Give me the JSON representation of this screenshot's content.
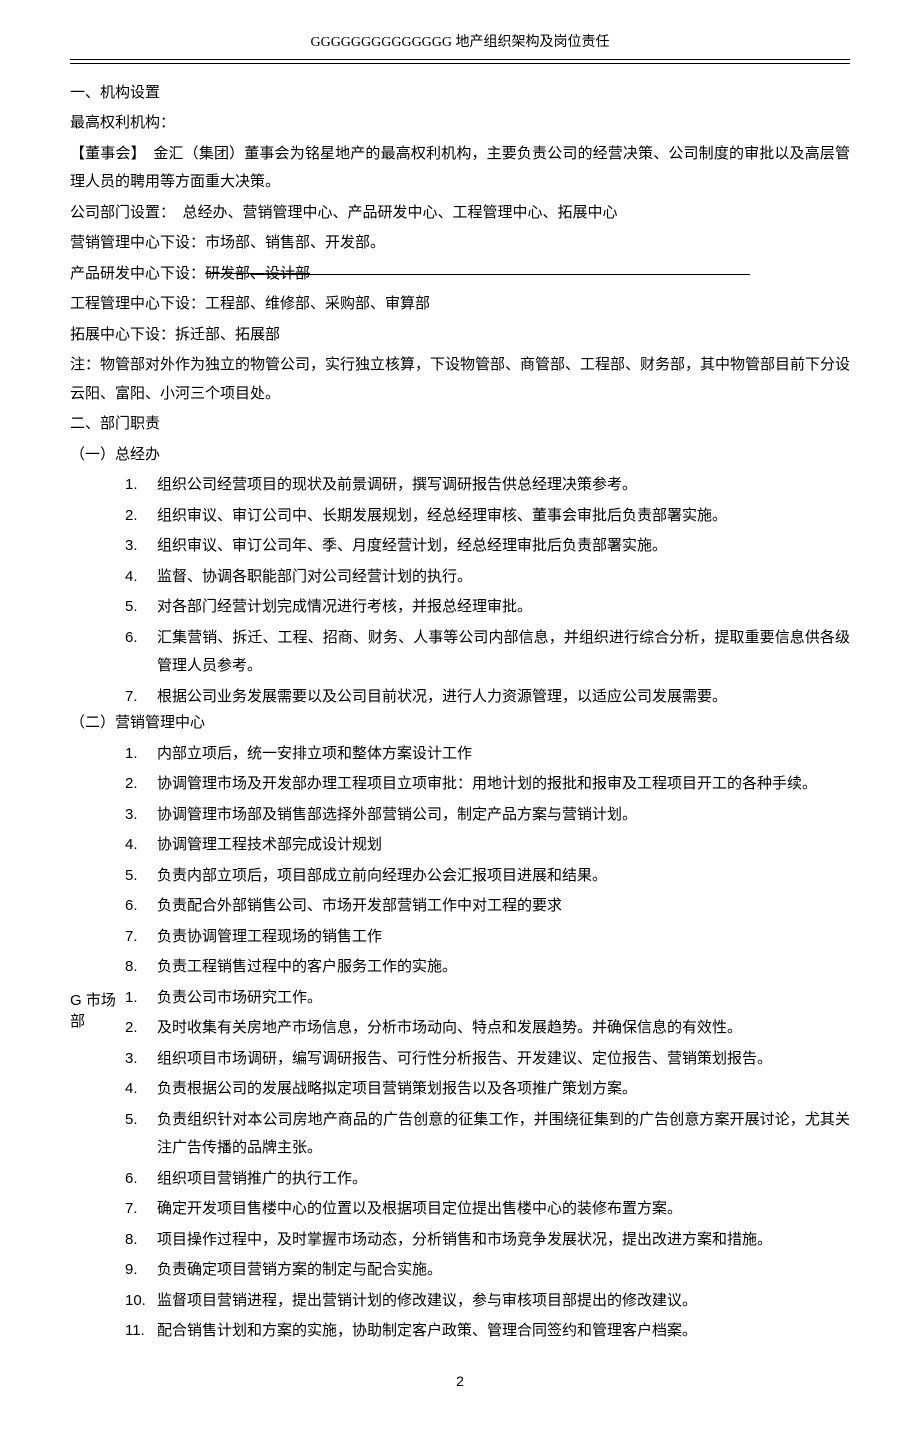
{
  "header": "GGGGGGGGGGGGGG 地产组织架构及岗位责任",
  "s1_title": "一、机构设置",
  "s1_l1": "最高权利机构：",
  "s1_l2": "【董事会】　金汇（集团）董事会为铭星地产的最高权利机构，主要负责公司的经营决策、公司制度的审批以及高层管理人员的聘用等方面重大决策。",
  "s1_l3": "公司部门设置：　总经办、营销管理中心、产品研发中心、工程管理中心、拓展中心",
  "s1_l4": "营销管理中心下设：市场部、销售部、开发部。",
  "s1_l5a": "产品研发中心下设：",
  "s1_l5b": "研发部、设计部",
  "s1_l6": "工程管理中心下设：工程部、维修部、采购部、审算部",
  "s1_l7": "拓展中心下设：拆迁部、拓展部",
  "s1_l8": "注：物管部对外作为独立的物管公司，实行独立核算，下设物管部、商管部、工程部、财务部，其中物管部目前下分设云阳、富阳、小河三个项目处。",
  "s2_title": "二、部门职责",
  "s2_sub1": "（一）总经办",
  "s2_sub1_items": [
    "组织公司经营项目的现状及前景调研，撰写调研报告供总经理决策参考。",
    "组织审议、审订公司中、长期发展规划，经总经理审核、董事会审批后负责部署实施。",
    "组织审议、审订公司年、季、月度经营计划，经总经理审批后负责部署实施。",
    "监督、协调各职能部门对公司经营计划的执行。",
    "对各部门经营计划完成情况进行考核，并报总经理审批。",
    "汇集营销、拆迁、工程、招商、财务、人事等公司内部信息，并组织进行综合分析，提取重要信息供各级管理人员参考。",
    "根据公司业务发展需要以及公司目前状况，进行人力资源管理，以适应公司发展需要。"
  ],
  "s2_sub2": "（二）营销管理中心",
  "s2_sub2_items": [
    "内部立项后，统一安排立项和整体方案设计工作",
    "协调管理市场及开发部办理工程项目立项审批：用地计划的报批和报审及工程项目开工的各种手续。",
    "协调管理市场部及销售部选择外部营销公司，制定产品方案与营销计划。",
    "协调管理工程技术部完成设计规划",
    "负责内部立项后，项目部成立前向经理办公会汇报项目进展和结果。",
    "负责配合外部销售公司、市场开发部营销工作中对工程的要求",
    "负责协调管理工程现场的销售工作",
    "负责工程销售过程中的客户服务工作的实施。"
  ],
  "s2_sub3_label": "G 市场部",
  "s2_sub3_items": [
    "负责公司市场研究工作。",
    "及时收集有关房地产市场信息，分析市场动向、特点和发展趋势。并确保信息的有效性。",
    "组织项目市场调研，编写调研报告、可行性分析报告、开发建议、定位报告、营销策划报告。",
    "负责根据公司的发展战略拟定项目营销策划报告以及各项推广策划方案。",
    "负责组织针对本公司房地产商品的广告创意的征集工作，并围绕征集到的广告创意方案开展讨论，尤其关注广告传播的品牌主张。",
    "组织项目营销推广的执行工作。",
    "确定开发项目售楼中心的位置以及根据项目定位提出售楼中心的装修布置方案。",
    "项目操作过程中，及时掌握市场动态，分析销售和市场竞争发展状况，提出改进方案和措施。",
    "负责确定项目营销方案的制定与配合实施。",
    "监督项目营销进程，提出营销计划的修改建议，参与审核项目部提出的修改建议。",
    "配合销售计划和方案的实施，协助制定客户政策、管理合同签约和管理客户档案。"
  ],
  "page_number": "2"
}
